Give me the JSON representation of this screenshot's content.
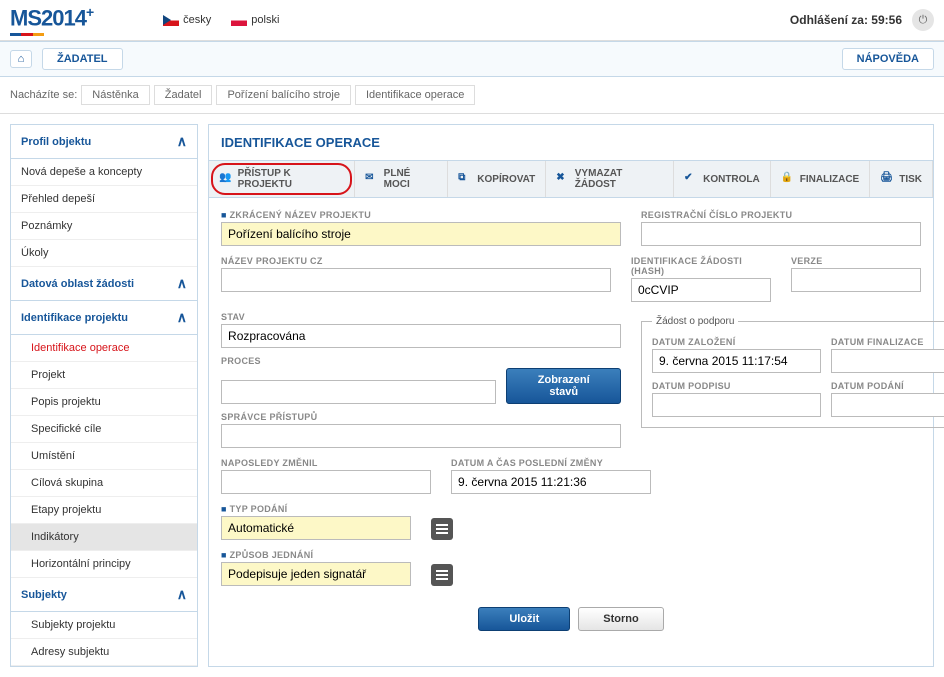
{
  "header": {
    "logo_main": "MS2014",
    "logo_plus": "+",
    "lang_cz": "česky",
    "lang_pl": "polski",
    "logout_label": "Odhlášení za:",
    "logout_time": "59:56"
  },
  "topbar": {
    "applicant": "ŽADATEL",
    "help": "NÁPOVĚDA"
  },
  "breadcrumb": {
    "label": "Nacházíte se:",
    "items": [
      "Nástěnka",
      "Žadatel",
      "Pořízení balícího stroje",
      "Identifikace operace"
    ]
  },
  "sidebar": {
    "s0": "Profil objektu",
    "s0_items": [
      "Nová depeše a koncepty",
      "Přehled depeší",
      "Poznámky",
      "Úkoly"
    ],
    "s1": "Datová oblast žádosti",
    "s2": "Identifikace projektu",
    "s2_items": [
      "Identifikace operace",
      "Projekt",
      "Popis projektu",
      "Specifické cíle",
      "Umístění",
      "Cílová skupina",
      "Etapy projektu",
      "Indikátory",
      "Horizontální principy"
    ],
    "s3": "Subjekty",
    "s3_items": [
      "Subjekty projektu",
      "Adresy subjektu"
    ]
  },
  "content": {
    "title": "IDENTIFIKACE OPERACE",
    "toolbar": {
      "access": "PŘÍSTUP K PROJEKTU",
      "plne": "PLNÉ MOCI",
      "copy": "KOPÍROVAT",
      "delete": "VYMAZAT ŽÁDOST",
      "check": "KONTROLA",
      "finalize": "FINALIZACE",
      "print": "TISK"
    },
    "form": {
      "short_name_label": "ZKRÁCENÝ NÁZEV PROJEKTU",
      "short_name": "Pořízení balícího stroje",
      "name_cz_label": "NÁZEV PROJEKTU CZ",
      "name_cz": "",
      "stav_label": "STAV",
      "stav": "Rozpracována",
      "proces_label": "PROCES",
      "proces": "",
      "show_states": "Zobrazení stavů",
      "admin_label": "SPRÁVCE PŘÍSTUPŮ",
      "admin": "",
      "last_mod_by_label": "NAPOSLEDY ZMĚNIL",
      "last_mod_by": "",
      "last_mod_at_label": "DATUM A ČAS POSLEDNÍ ZMĚNY",
      "last_mod_at": "9. června 2015 11:21:36",
      "typ_podani_label": "TYP PODÁNÍ",
      "typ_podani": "Automatické",
      "zpusob_label": "ZPŮSOB JEDNÁNÍ",
      "zpusob": "Podepisuje jeden signatář",
      "reg_num_label": "REGISTRAČNÍ ČÍSLO PROJEKTU",
      "reg_num": "",
      "hash_label": "IDENTIFIKACE ŽÁDOSTI (HASH)",
      "hash": "0cCVIP",
      "verze_label": "VERZE",
      "verze": "",
      "fieldset_title": "Žádost o podporu",
      "date_created_label": "DATUM ZALOŽENÍ",
      "date_created": "9. června 2015 11:17:54",
      "date_final_label": "DATUM FINALIZACE",
      "date_final": "",
      "date_sign_label": "DATUM PODPISU",
      "date_sign": "",
      "date_submit_label": "DATUM PODÁNÍ",
      "date_submit": "",
      "save": "Uložit",
      "cancel": "Storno"
    }
  }
}
